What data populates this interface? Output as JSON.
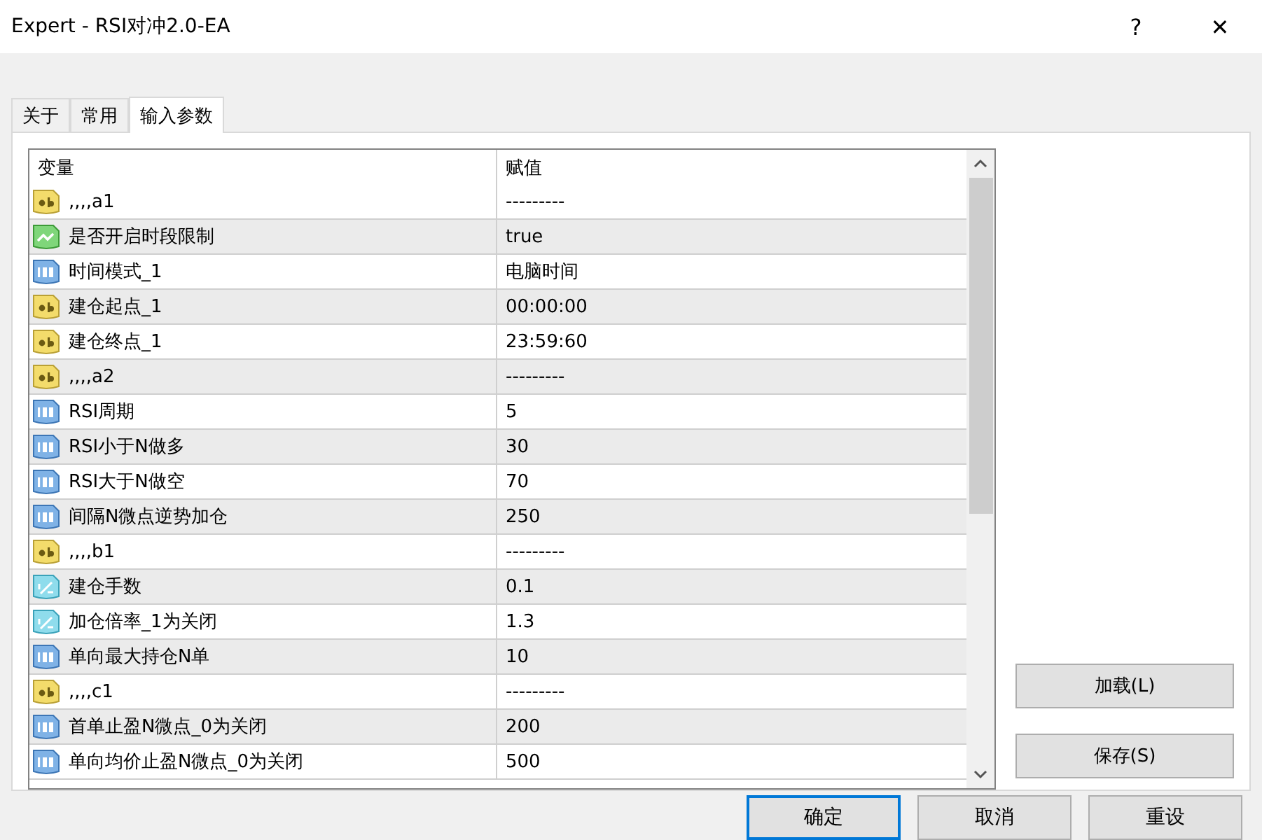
{
  "window": {
    "title": "Expert - RSI对冲2.0-EA",
    "help": "?",
    "close": "✕"
  },
  "tabs": [
    {
      "label": "关于",
      "selected": false
    },
    {
      "label": "常用",
      "selected": false
    },
    {
      "label": "输入参数",
      "selected": true
    }
  ],
  "table": {
    "columns": [
      "变量",
      "赋值"
    ],
    "rows": [
      {
        "kind": "string",
        "name": ",,,,a1",
        "value": "---------"
      },
      {
        "kind": "bool",
        "name": "是否开启时段限制",
        "value": "true"
      },
      {
        "kind": "int",
        "name": "时间模式_1",
        "value": "电脑时间"
      },
      {
        "kind": "string",
        "name": "建仓起点_1",
        "value": "00:00:00"
      },
      {
        "kind": "string",
        "name": "建仓终点_1",
        "value": "23:59:60"
      },
      {
        "kind": "string",
        "name": ",,,,a2",
        "value": "---------"
      },
      {
        "kind": "int",
        "name": "RSI周期",
        "value": "5"
      },
      {
        "kind": "int",
        "name": "RSI小于N做多",
        "value": "30"
      },
      {
        "kind": "int",
        "name": "RSI大于N做空",
        "value": "70"
      },
      {
        "kind": "int",
        "name": "间隔N微点逆势加仓",
        "value": "250"
      },
      {
        "kind": "string",
        "name": ",,,,b1",
        "value": "---------"
      },
      {
        "kind": "double",
        "name": "建仓手数",
        "value": "0.1"
      },
      {
        "kind": "double",
        "name": "加仓倍率_1为关闭",
        "value": "1.3"
      },
      {
        "kind": "int",
        "name": "单向最大持仓N单",
        "value": "10"
      },
      {
        "kind": "string",
        "name": ",,,,c1",
        "value": "---------"
      },
      {
        "kind": "int",
        "name": "首单止盈N微点_0为关闭",
        "value": "200"
      },
      {
        "kind": "int",
        "name": "单向均价止盈N微点_0为关闭",
        "value": "500"
      }
    ]
  },
  "side_buttons": [
    "加载(L)",
    "保存(S)"
  ],
  "buttons": [
    {
      "label": "确定",
      "selected": true
    },
    {
      "label": "取消",
      "selected": false
    },
    {
      "label": "重设",
      "selected": false
    }
  ]
}
